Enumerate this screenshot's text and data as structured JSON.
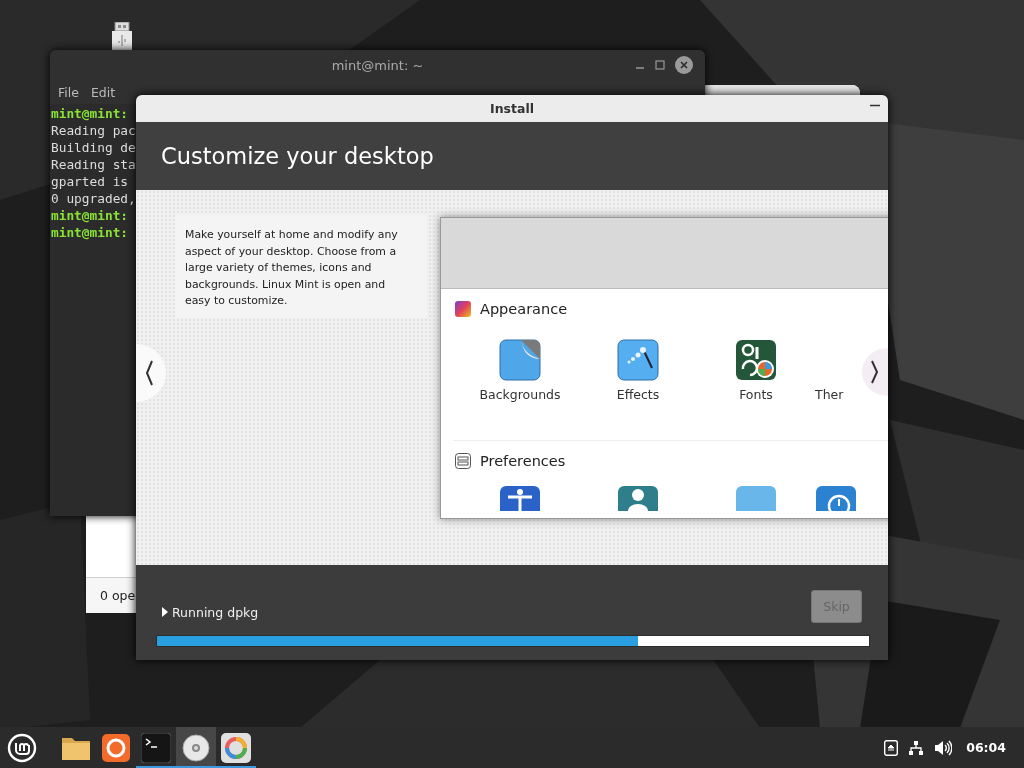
{
  "terminal": {
    "title": "mint@mint: ~",
    "menu": [
      "File",
      "Edit"
    ],
    "lines": [
      {
        "kind": "prompt",
        "text": "mint@mint:"
      },
      {
        "kind": "output",
        "text": "Reading pac"
      },
      {
        "kind": "output",
        "text": "Building de"
      },
      {
        "kind": "output",
        "text": "Reading sta"
      },
      {
        "kind": "output",
        "text": "gparted is"
      },
      {
        "kind": "output",
        "text": "0 upgraded,"
      },
      {
        "kind": "prompt",
        "text": "mint@mint:"
      },
      {
        "kind": "prompt",
        "text": "mint@mint:"
      }
    ]
  },
  "back_window": {
    "status": "0 ope"
  },
  "install": {
    "title": "Install",
    "heading": "Customize your desktop",
    "description": "Make yourself at home and modify any aspect of your desktop. Choose from a large variety of themes, icons and backgrounds. Linux Mint is open and easy to customize.",
    "preview": {
      "sections": [
        {
          "kind": "appearance",
          "title": "Appearance",
          "items": [
            {
              "kind": "backgrounds",
              "label": "Backgrounds"
            },
            {
              "kind": "effects",
              "label": "Effects"
            },
            {
              "kind": "fonts",
              "label": "Fonts"
            },
            {
              "kind": "themes",
              "label": "Ther"
            }
          ]
        },
        {
          "kind": "preferences",
          "title": "Preferences",
          "items": [
            {
              "kind": "accessibility"
            },
            {
              "kind": "account"
            },
            {
              "kind": "blank"
            },
            {
              "kind": "clock"
            }
          ]
        }
      ]
    },
    "status": "Running dpkg",
    "skip": {
      "label": "Skip",
      "disabled": true
    },
    "progress": {
      "level": 0.675
    }
  },
  "taskbar": {
    "apps": [
      {
        "kind": "menu",
        "running": false,
        "focused": false
      },
      {
        "kind": "files",
        "running": false,
        "focused": false
      },
      {
        "kind": "browser",
        "running": false,
        "focused": false
      },
      {
        "kind": "terminal",
        "running": true,
        "focused": false
      },
      {
        "kind": "disc",
        "running": true,
        "focused": true
      },
      {
        "kind": "installer",
        "running": true,
        "focused": false
      }
    ],
    "clock": "06:04"
  }
}
